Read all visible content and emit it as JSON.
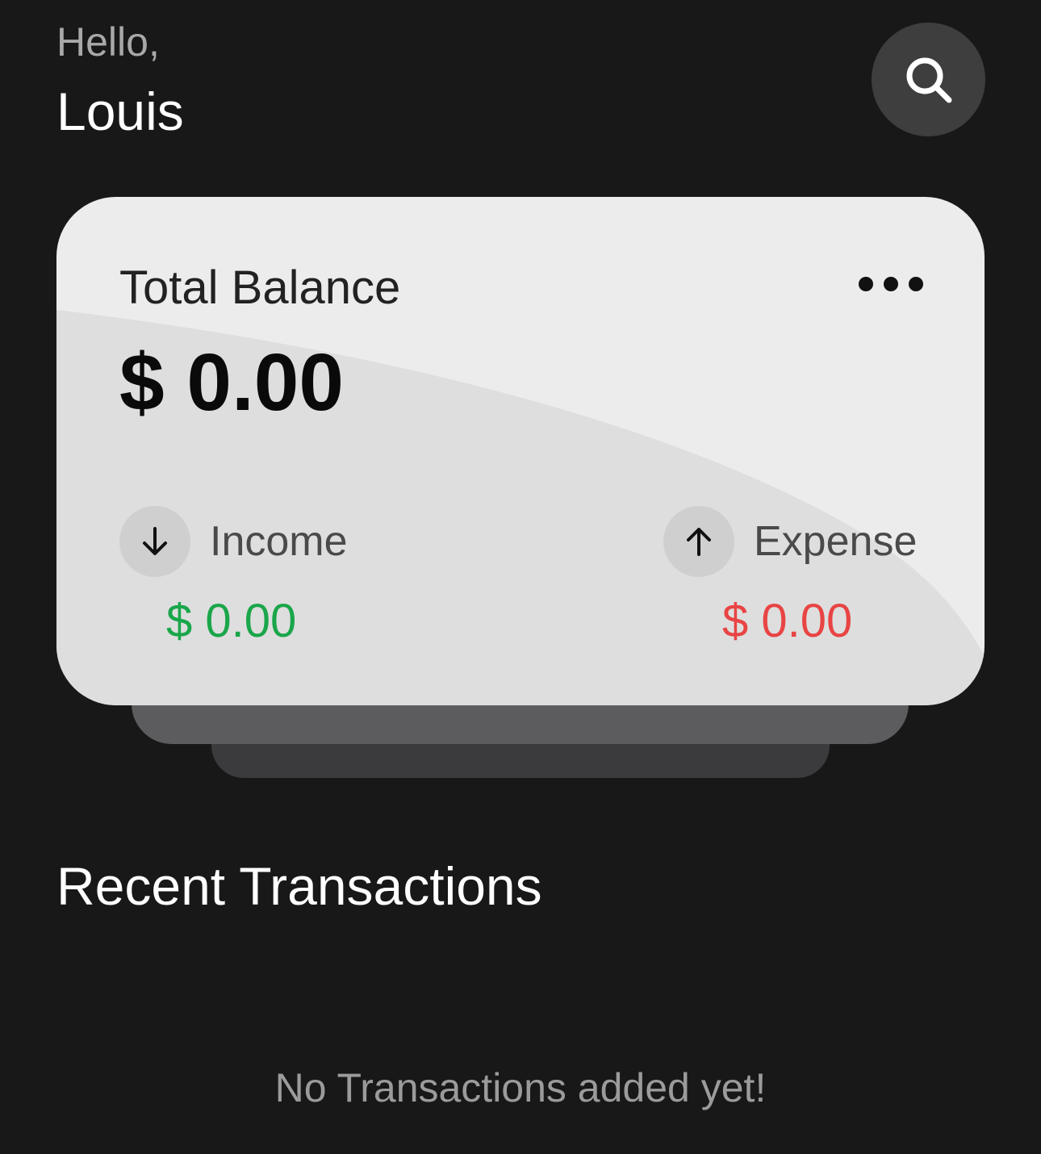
{
  "header": {
    "greeting": "Hello,",
    "username": "Louis",
    "search_icon": "search-icon"
  },
  "balance_card": {
    "title": "Total Balance",
    "amount": "$ 0.00",
    "menu_icon": "more-horizontal-icon",
    "income": {
      "label": "Income",
      "amount": "$ 0.00",
      "icon": "arrow-down-icon",
      "color": "#1aa64a"
    },
    "expense": {
      "label": "Expense",
      "amount": "$ 0.00",
      "icon": "arrow-up-icon",
      "color": "#e94444"
    }
  },
  "transactions": {
    "title": "Recent Transactions",
    "empty_message": "No Transactions added yet!"
  },
  "colors": {
    "background": "#181818",
    "card": "#ececec",
    "card_wave": "#dedede"
  }
}
